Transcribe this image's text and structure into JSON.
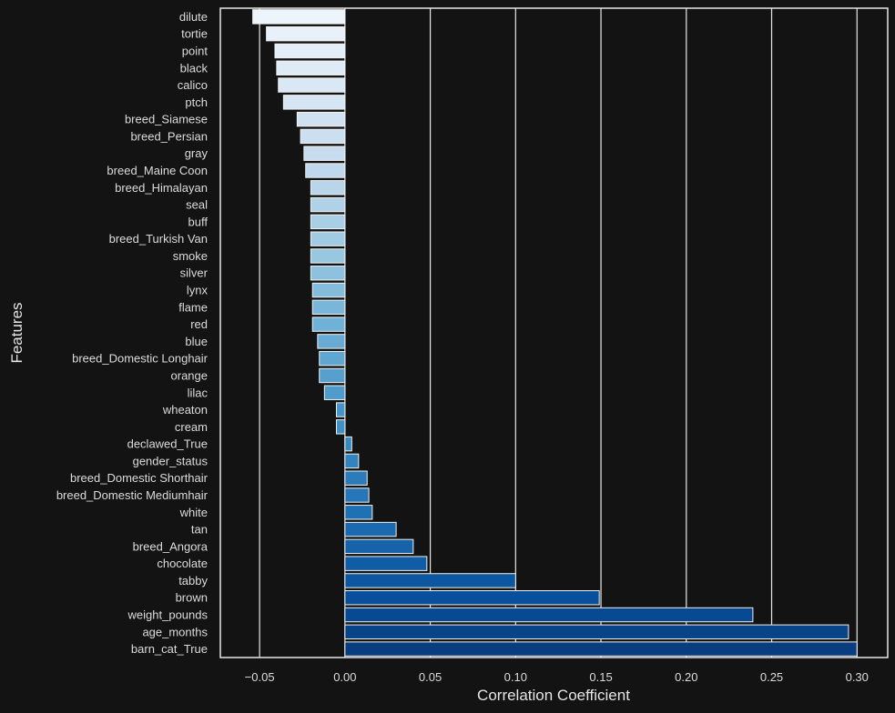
{
  "chart_data": {
    "type": "bar",
    "orientation": "horizontal",
    "title": "",
    "xlabel": "Correlation Coefficient",
    "ylabel": "Features",
    "xlim": [
      -0.073,
      0.318
    ],
    "grid": "vertical",
    "colormap": "Blues",
    "xticks": [
      -0.05,
      0.0,
      0.05,
      0.1,
      0.15,
      0.2,
      0.25,
      0.3
    ],
    "xtick_labels": [
      "−0.05",
      "0.00",
      "0.05",
      "0.10",
      "0.15",
      "0.20",
      "0.25",
      "0.30"
    ],
    "categories": [
      "dilute",
      "tortie",
      "point",
      "black",
      "calico",
      "ptch",
      "breed_Siamese",
      "breed_Persian",
      "gray",
      "breed_Maine Coon",
      "breed_Himalayan",
      "seal",
      "buff",
      "breed_Turkish Van",
      "smoke",
      "silver",
      "lynx",
      "flame",
      "red",
      "blue",
      "breed_Domestic Longhair",
      "orange",
      "lilac",
      "wheaton",
      "cream",
      "declawed_True",
      "gender_status",
      "breed_Domestic Shorthair",
      "breed_Domestic Mediumhair",
      "white",
      "tan",
      "breed_Angora",
      "chocolate",
      "tabby",
      "brown",
      "weight_pounds",
      "age_months",
      "barn_cat_True"
    ],
    "values": [
      -0.054,
      -0.046,
      -0.041,
      -0.04,
      -0.039,
      -0.036,
      -0.028,
      -0.026,
      -0.024,
      -0.023,
      -0.02,
      -0.02,
      -0.02,
      -0.02,
      -0.02,
      -0.02,
      -0.019,
      -0.019,
      -0.019,
      -0.016,
      -0.015,
      -0.015,
      -0.012,
      -0.005,
      -0.005,
      0.004,
      0.008,
      0.013,
      0.014,
      0.016,
      0.03,
      0.04,
      0.048,
      0.1,
      0.149,
      0.239,
      0.295,
      0.3
    ]
  }
}
